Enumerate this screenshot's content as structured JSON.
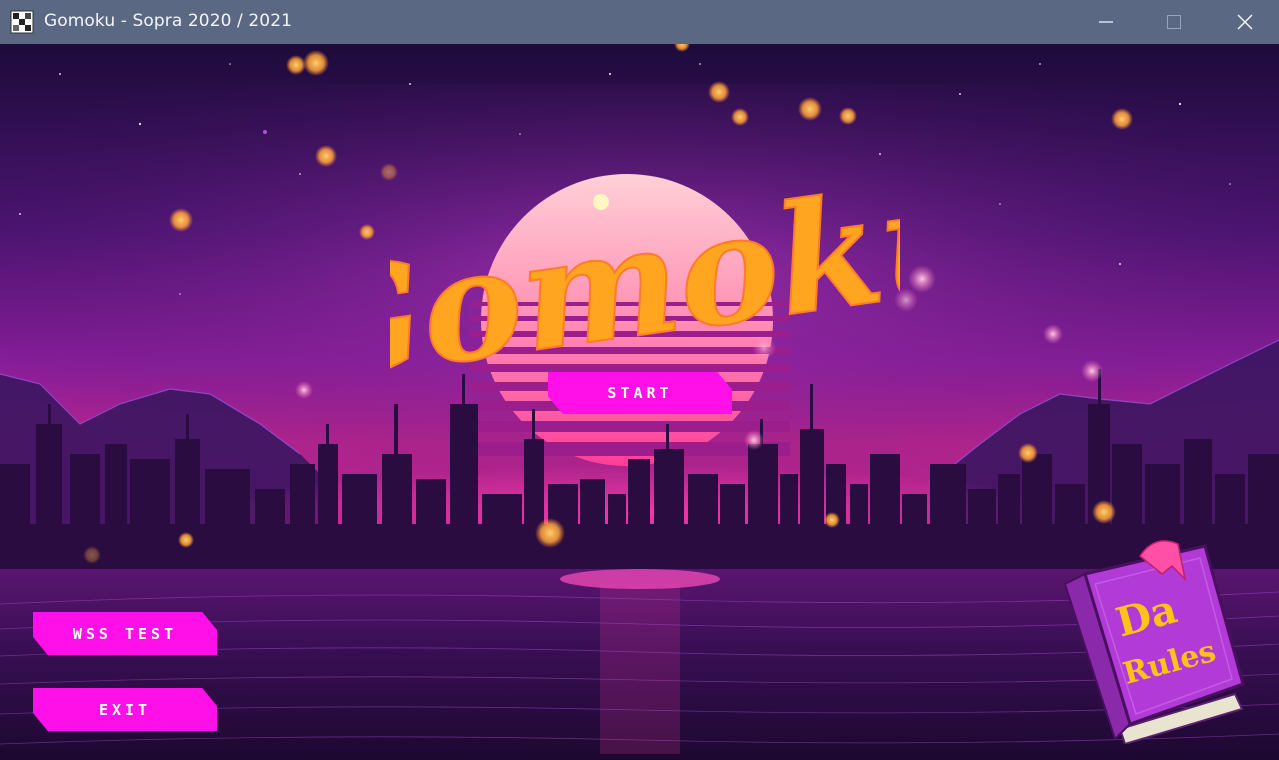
{
  "window": {
    "title": "Gomoku - Sopra 2020 / 2021",
    "controls": [
      "minimize",
      "maximize",
      "close"
    ]
  },
  "game": {
    "logo_text": "Gomoku"
  },
  "menu": {
    "start_label": "START",
    "wss_test_label": "WSS TEST",
    "exit_label": "EXIT"
  },
  "rules_book": {
    "line1": "Da",
    "line2": "Rules"
  },
  "colors": {
    "titlebar": "#5a6884",
    "button": "#ff10e8",
    "logo": "#ffa51f",
    "book": "#b23ad6",
    "book_text": "#ffc21a"
  }
}
